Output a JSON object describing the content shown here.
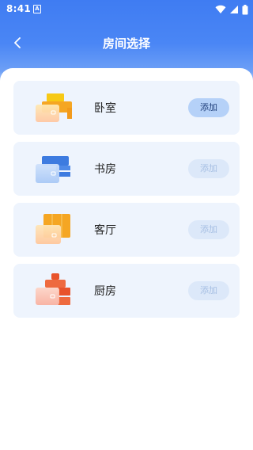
{
  "status_bar": {
    "time": "8:41",
    "notification_glyph": "A"
  },
  "header": {
    "title": "房间选择",
    "back_icon": "chevron-left-icon"
  },
  "rooms": [
    {
      "label": "卧室",
      "add_label": "添加",
      "icon": "bedroom-icon",
      "state": "active"
    },
    {
      "label": "书房",
      "add_label": "添加",
      "icon": "study-icon",
      "state": "disabled"
    },
    {
      "label": "客厅",
      "add_label": "添加",
      "icon": "living-room-icon",
      "state": "disabled"
    },
    {
      "label": "厨房",
      "add_label": "添加",
      "icon": "kitchen-icon",
      "state": "disabled"
    }
  ],
  "colors": {
    "header_blue": "#3f7cf2",
    "card_bg": "#eef4fd"
  }
}
